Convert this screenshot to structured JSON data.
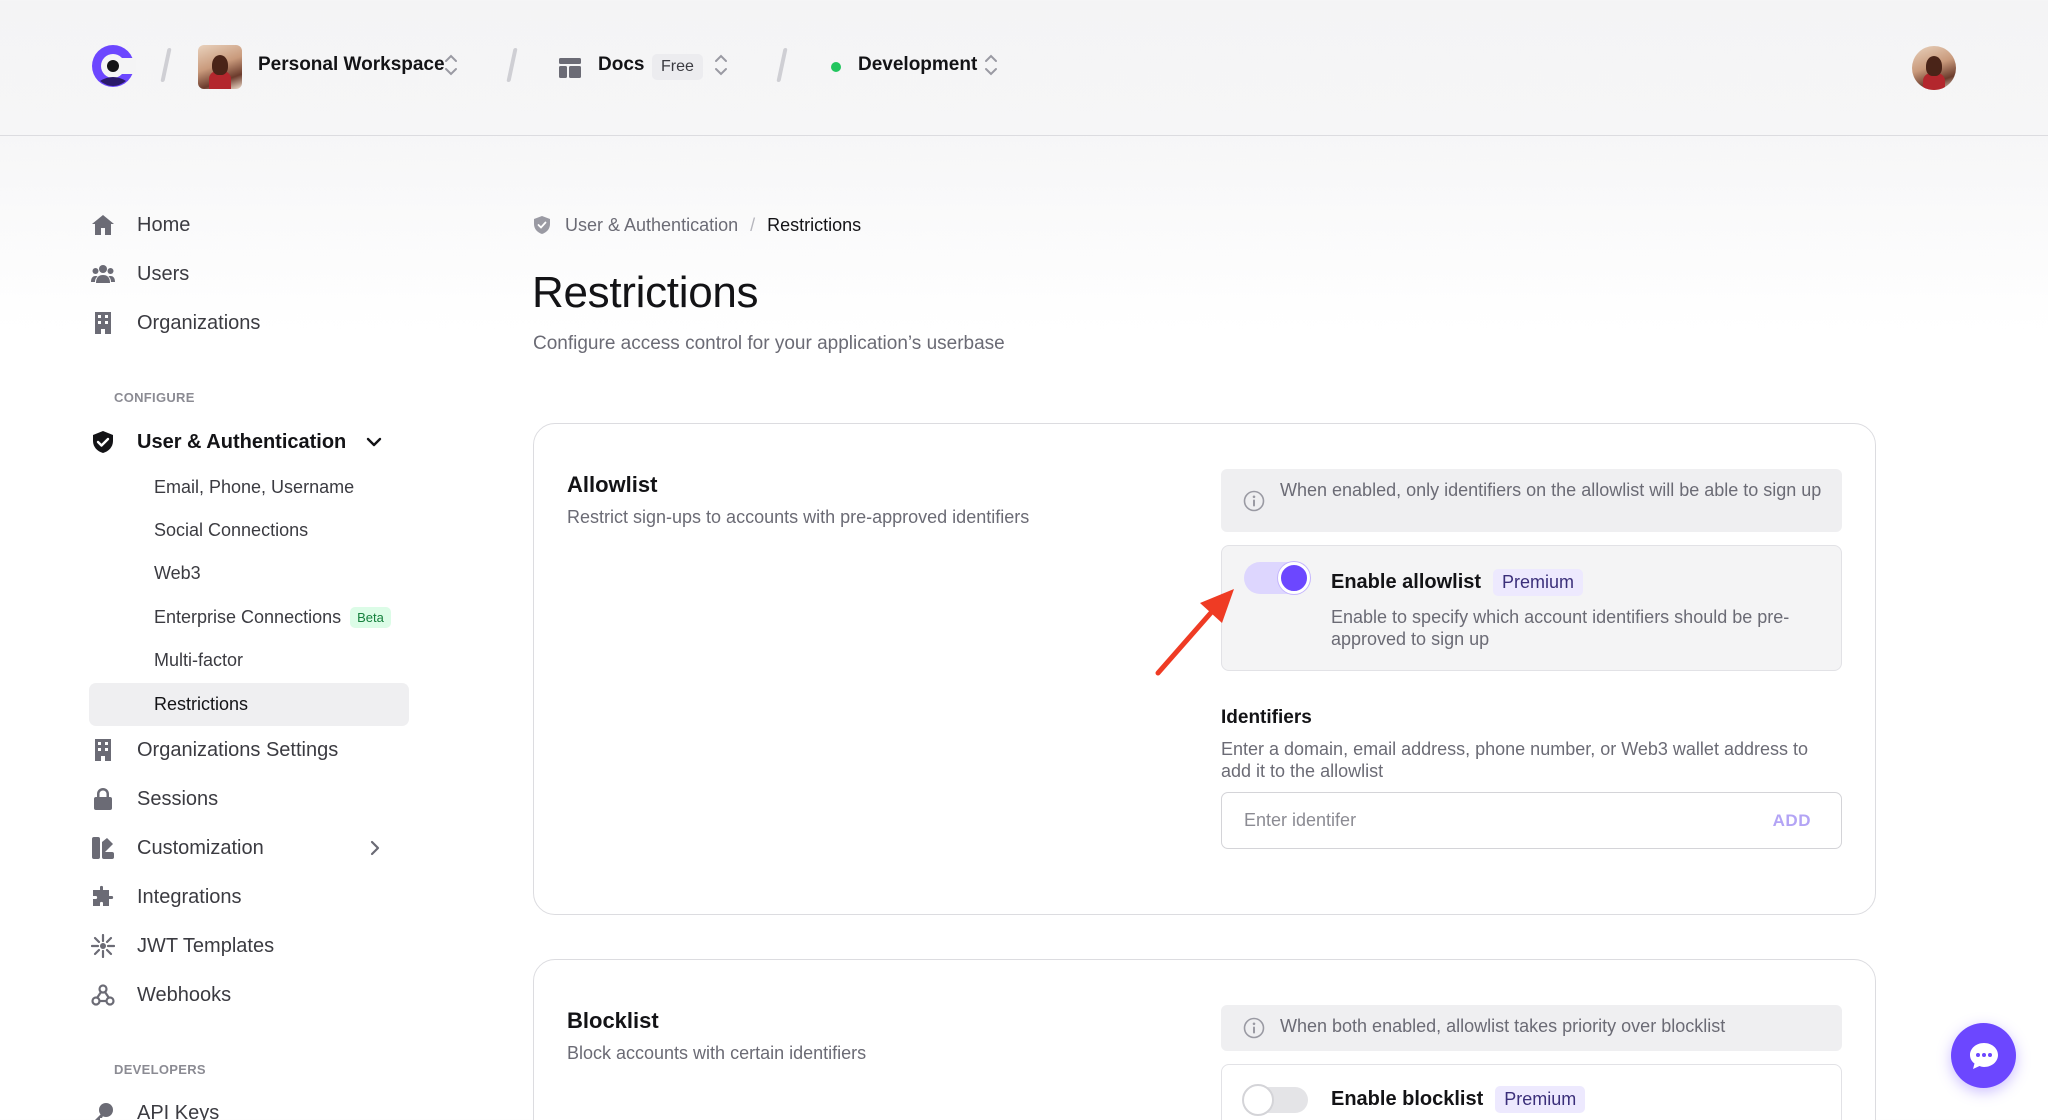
{
  "topbar": {
    "workspace": "Personal Workspace",
    "app": "Docs",
    "app_plan": "Free",
    "environment": "Development",
    "environment_color": "#22c55e"
  },
  "sidebar": {
    "top_items": [
      {
        "label": "Home",
        "icon": "home-icon"
      },
      {
        "label": "Users",
        "icon": "users-icon"
      },
      {
        "label": "Organizations",
        "icon": "building-icon"
      }
    ],
    "configure_heading": "CONFIGURE",
    "user_auth": {
      "label": "User & Authentication",
      "icon": "shield-icon",
      "children": [
        {
          "label": "Email, Phone, Username"
        },
        {
          "label": "Social Connections"
        },
        {
          "label": "Web3"
        },
        {
          "label": "Enterprise Connections",
          "badge": "Beta"
        },
        {
          "label": "Multi-factor"
        },
        {
          "label": "Restrictions",
          "selected": true
        }
      ]
    },
    "configure_items": [
      {
        "label": "Organizations Settings",
        "icon": "building-icon"
      },
      {
        "label": "Sessions",
        "icon": "lock-icon"
      },
      {
        "label": "Customization",
        "icon": "brush-icon"
      },
      {
        "label": "Integrations",
        "icon": "puzzle-icon"
      },
      {
        "label": "JWT Templates",
        "icon": "sparkle-icon"
      },
      {
        "label": "Webhooks",
        "icon": "webhook-icon"
      }
    ],
    "developers_heading": "DEVELOPERS",
    "developer_items": [
      {
        "label": "API Keys",
        "icon": "key-icon"
      }
    ]
  },
  "breadcrumb": {
    "parent": "User & Authentication",
    "separator": "/",
    "current": "Restrictions"
  },
  "page": {
    "title": "Restrictions",
    "subtitle": "Configure access control for your application’s userbase"
  },
  "allowlist": {
    "title": "Allowlist",
    "description": "Restrict sign-ups to accounts with pre-approved identifiers",
    "info": "When enabled, only identifiers on the allowlist will be able to sign up",
    "toggle_label": "Enable allowlist",
    "toggle_badge": "Premium",
    "toggle_on": true,
    "toggle_description": "Enable to specify which account identifiers should be pre-approved to sign up",
    "identifiers_title": "Identifiers",
    "identifiers_description": "Enter a domain, email address, phone number, or Web3 wallet address to add it to the allowlist",
    "input_placeholder": "Enter identifer",
    "input_value": "",
    "add_label": "ADD"
  },
  "blocklist": {
    "title": "Blocklist",
    "description": "Block accounts with certain identifiers",
    "info": "When both enabled, allowlist takes priority over blocklist",
    "toggle_label": "Enable blocklist",
    "toggle_badge": "Premium",
    "toggle_on": false
  },
  "colors": {
    "accent": "#6c47ff",
    "annotation_arrow": "#ef3b24"
  }
}
